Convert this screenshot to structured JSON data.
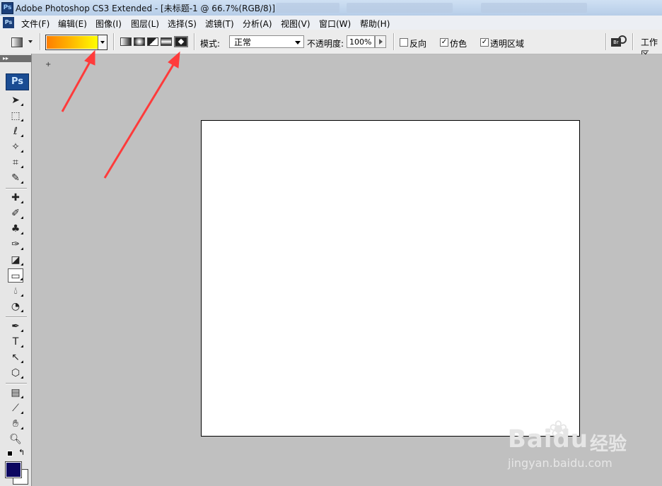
{
  "window": {
    "title": "Adobe Photoshop CS3 Extended - [未标题-1 @ 66.7%(RGB/8)]",
    "app_icon": "Ps"
  },
  "menu": {
    "items": [
      "文件(F)",
      "编辑(E)",
      "图像(I)",
      "图层(L)",
      "选择(S)",
      "滤镜(T)",
      "分析(A)",
      "视图(V)",
      "窗口(W)",
      "帮助(H)"
    ]
  },
  "options": {
    "gradient_colors": [
      "#ff7e00",
      "#ffb300",
      "#ffff00"
    ],
    "gradient_types": [
      "linear-gradient-icon",
      "radial-gradient-icon",
      "angle-gradient-icon",
      "reflected-gradient-icon",
      "diamond-gradient-icon"
    ],
    "mode_label": "模式:",
    "mode_value": "正常",
    "opacity_label": "不透明度:",
    "opacity_value": "100%",
    "reverse_label": "反向",
    "reverse_checked": false,
    "dither_label": "仿色",
    "dither_checked": true,
    "transparency_label": "透明区域",
    "transparency_checked": true,
    "bridge_label": "Br",
    "workspace_label": "工作区"
  },
  "toolbox": {
    "logo": "Ps",
    "foreground_color": "#0c0660",
    "background_color": "#ffffff"
  },
  "annotation": {
    "arrow_color": "#ff3b3b"
  },
  "watermark": {
    "brand": "Bai",
    "brand_suffix": "du",
    "product": "经验",
    "url": "jingyan.baidu.com"
  }
}
